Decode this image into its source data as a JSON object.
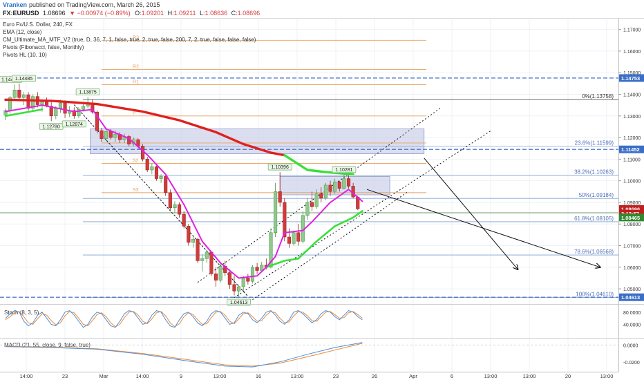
{
  "header": {
    "author": "Vranken",
    "published": "published on TradingView.com, March 26, 2015",
    "symbol": "FX:EURUSD",
    "last": "1.08696",
    "change": "▼ −0.00974 (−0.89%)",
    "ohlc": [
      {
        "k": "O:",
        "v": "1.09201"
      },
      {
        "k": "H:",
        "v": "1.09211"
      },
      {
        "k": "L:",
        "v": "1.08636"
      },
      {
        "k": "C:",
        "v": "1.08696"
      }
    ]
  },
  "studies": [
    "Euro Fx/U.S. Dollar, 240, FX",
    "EMA (12, close)",
    "CM_Ultimate_MA_MTF_V2 (true, D, 36, 7, 1, false, true, 2, true, false, 200, 7, 2, true, false, false, false)",
    "Pivots (Fibonacci, false, Monthly)",
    "Pivots HL (10, 10)"
  ],
  "colors": {
    "up_candle": "#8fc98c",
    "down_candle": "#d33b3b",
    "ma_red": "#e02020",
    "ma_green": "#39e039",
    "ema_magenta": "#e020e0",
    "pivot": "#e8a060",
    "fib": "#7f9fd0",
    "fib_text": "#4f6fb8",
    "dash_blue": "#3060c0",
    "price_tag": "#c02020",
    "green_tag": "#2f8a2f",
    "blue_tag": "#3a6fc8",
    "stoch_k": "#4f8fd8",
    "stoch_d": "#e88a3a",
    "zone": "#c8cde6"
  },
  "chart_data": {
    "type": "candlestick",
    "y_axis": {
      "ylim": [
        1.043,
        1.175
      ],
      "ticks": [
        "1.17000",
        "1.16000",
        "1.15000",
        "1.14000",
        "1.13000",
        "1.12000",
        "1.11000",
        "1.10000",
        "1.09000",
        "1.08000",
        "1.07000",
        "1.06000",
        "1.05000"
      ]
    },
    "x_axis": {
      "labels": [
        "14:00",
        "23",
        "Mar",
        "14:00",
        "9",
        "13:00",
        "16",
        "13:00",
        "23",
        "26",
        "Apr",
        "6",
        "13:00",
        "13:00",
        "20",
        "13:00"
      ]
    },
    "candles": [
      [
        1.1305,
        1.1335,
        1.128,
        1.1325
      ],
      [
        1.1325,
        1.1392,
        1.131,
        1.1385
      ],
      [
        1.1385,
        1.1445,
        1.1375,
        1.142
      ],
      [
        1.142,
        1.145,
        1.1375,
        1.1385
      ],
      [
        1.1385,
        1.141,
        1.135,
        1.1398
      ],
      [
        1.1398,
        1.141,
        1.1325,
        1.1335
      ],
      [
        1.1335,
        1.14,
        1.132,
        1.139
      ],
      [
        1.139,
        1.141,
        1.134,
        1.1352
      ],
      [
        1.1352,
        1.1375,
        1.132,
        1.1365
      ],
      [
        1.1365,
        1.1385,
        1.134,
        1.1345
      ],
      [
        1.1345,
        1.137,
        1.1276,
        1.13
      ],
      [
        1.13,
        1.1345,
        1.1285,
        1.1335
      ],
      [
        1.1335,
        1.1375,
        1.1315,
        1.136
      ],
      [
        1.136,
        1.1372,
        1.129,
        1.1312
      ],
      [
        1.1312,
        1.1345,
        1.1295,
        1.1325
      ],
      [
        1.1325,
        1.134,
        1.1287,
        1.13
      ],
      [
        1.13,
        1.134,
        1.129,
        1.133
      ],
      [
        1.133,
        1.136,
        1.132,
        1.1345
      ],
      [
        1.1345,
        1.1387,
        1.1335,
        1.136
      ],
      [
        1.136,
        1.1375,
        1.131,
        1.1318
      ],
      [
        1.1318,
        1.1325,
        1.122,
        1.1232
      ],
      [
        1.1232,
        1.1245,
        1.118,
        1.1195
      ],
      [
        1.1195,
        1.124,
        1.1185,
        1.1228
      ],
      [
        1.1228,
        1.124,
        1.119,
        1.12
      ],
      [
        1.12,
        1.1232,
        1.118,
        1.1215
      ],
      [
        1.1215,
        1.1225,
        1.1175,
        1.119
      ],
      [
        1.119,
        1.1218,
        1.1175,
        1.1205
      ],
      [
        1.1205,
        1.1212,
        1.116,
        1.117
      ],
      [
        1.117,
        1.12,
        1.116,
        1.119
      ],
      [
        1.119,
        1.1195,
        1.115,
        1.116
      ],
      [
        1.116,
        1.117,
        1.109,
        1.11
      ],
      [
        1.11,
        1.111,
        1.104,
        1.105
      ],
      [
        1.105,
        1.108,
        1.103,
        1.1065
      ],
      [
        1.1065,
        1.107,
        1.1,
        1.101
      ],
      [
        1.101,
        1.103,
        1.099,
        1.102
      ],
      [
        1.102,
        1.1025,
        1.093,
        1.0945
      ],
      [
        1.0945,
        1.096,
        1.086,
        1.0875
      ],
      [
        1.0875,
        1.0905,
        1.085,
        1.089
      ],
      [
        1.089,
        1.09,
        1.083,
        1.0845
      ],
      [
        1.0845,
        1.086,
        1.078,
        1.079
      ],
      [
        1.079,
        1.08,
        1.07,
        1.0715
      ],
      [
        1.0715,
        1.074,
        1.069,
        1.073
      ],
      [
        1.073,
        1.0735,
        1.062,
        1.063
      ],
      [
        1.063,
        1.066,
        1.058,
        1.064
      ],
      [
        1.064,
        1.068,
        1.062,
        1.067
      ],
      [
        1.067,
        1.0675,
        1.056,
        1.057
      ],
      [
        1.057,
        1.06,
        1.051,
        1.054
      ],
      [
        1.054,
        1.062,
        1.053,
        1.0605
      ],
      [
        1.0605,
        1.063,
        1.056,
        1.0575
      ],
      [
        1.0575,
        1.059,
        1.05,
        1.052
      ],
      [
        1.052,
        1.056,
        1.047,
        1.049
      ],
      [
        1.049,
        1.052,
        1.0462,
        1.051
      ],
      [
        1.051,
        1.056,
        1.049,
        1.055
      ],
      [
        1.055,
        1.057,
        1.052,
        1.0535
      ],
      [
        1.0535,
        1.061,
        1.0525,
        1.06
      ],
      [
        1.06,
        1.062,
        1.057,
        1.0585
      ],
      [
        1.0585,
        1.0625,
        1.058,
        1.061
      ],
      [
        1.061,
        1.064,
        1.059,
        1.06
      ],
      [
        1.06,
        1.078,
        1.0595,
        1.076
      ],
      [
        1.076,
        1.099,
        1.074,
        1.095
      ],
      [
        1.095,
        1.104,
        1.088,
        1.09
      ],
      [
        1.09,
        1.092,
        1.072,
        1.074
      ],
      [
        1.074,
        1.078,
        1.069,
        1.071
      ],
      [
        1.071,
        1.077,
        1.07,
        1.076
      ],
      [
        1.076,
        1.08,
        1.07,
        1.072
      ],
      [
        1.072,
        1.086,
        1.071,
        1.084
      ],
      [
        1.084,
        1.092,
        1.082,
        1.09
      ],
      [
        1.09,
        1.095,
        1.086,
        1.088
      ],
      [
        1.088,
        1.096,
        1.087,
        1.094
      ],
      [
        1.094,
        1.097,
        1.09,
        1.092
      ],
      [
        1.092,
        1.099,
        1.091,
        1.098
      ],
      [
        1.098,
        1.1,
        1.093,
        1.095
      ],
      [
        1.095,
        1.101,
        1.094,
        1.0995
      ],
      [
        1.0995,
        1.1,
        1.095,
        1.0965
      ],
      [
        1.0965,
        1.1028,
        1.096,
        1.101
      ],
      [
        1.101,
        1.1025,
        1.0965,
        1.0975
      ],
      [
        1.0975,
        1.099,
        1.092,
        1.0925
      ],
      [
        1.0925,
        1.093,
        1.0864,
        1.087
      ]
    ],
    "red_ma": [
      [
        0,
        1.1375
      ],
      [
        10,
        1.137
      ],
      [
        20,
        1.1355
      ],
      [
        30,
        1.132
      ],
      [
        38,
        1.128
      ],
      [
        46,
        1.1225
      ],
      [
        52,
        1.117
      ],
      [
        58,
        1.113
      ],
      [
        61,
        1.1118
      ]
    ],
    "green_ma": [
      [
        61,
        1.1118
      ],
      [
        66,
        1.105
      ],
      [
        70,
        1.104
      ],
      [
        76,
        1.103
      ]
    ],
    "ema12": [
      [
        0,
        1.132
      ],
      [
        8,
        1.135
      ],
      [
        15,
        1.132
      ],
      [
        19,
        1.133
      ],
      [
        22,
        1.124
      ],
      [
        27,
        1.1195
      ],
      [
        31,
        1.112
      ],
      [
        35,
        1.103
      ],
      [
        39,
        1.089
      ],
      [
        43,
        1.072
      ],
      [
        47,
        1.062
      ],
      [
        51,
        1.055
      ],
      [
        55,
        1.056
      ],
      [
        57,
        1.06
      ],
      [
        59,
        1.065
      ],
      [
        61,
        1.076
      ],
      [
        65,
        1.077
      ],
      [
        67,
        1.081
      ],
      [
        71,
        1.09
      ],
      [
        75,
        1.096
      ],
      [
        78,
        1.0905
      ]
    ],
    "ema_slow_green": [
      [
        0,
        1.13
      ],
      [
        8,
        1.133
      ]
    ],
    "ema_slow_green2": [
      [
        57,
        1.06
      ],
      [
        61,
        1.063
      ],
      [
        64,
        1.064
      ],
      [
        68,
        1.072
      ],
      [
        72,
        1.079
      ],
      [
        76,
        1.083
      ],
      [
        78,
        1.086
      ]
    ],
    "pivots": [
      {
        "label": "R3",
        "value": 1.165,
        "from": 21,
        "to": 92
      },
      {
        "label": "R2",
        "value": 1.1515,
        "from": 21,
        "to": 92
      },
      {
        "label": "R1",
        "value": 1.1445,
        "from": 21,
        "to": 92
      },
      {
        "label": "P",
        "value": 1.13,
        "from": 21,
        "to": 92
      },
      {
        "label": "S1",
        "value": 1.1175,
        "from": 21,
        "to": 92
      },
      {
        "label": "S2",
        "value": 1.108,
        "from": 21,
        "to": 92
      },
      {
        "label": "S3",
        "value": 1.0945,
        "from": 21,
        "to": 92
      }
    ],
    "fib_levels": [
      {
        "label": "0%(1.13758)",
        "value": 1.13758
      },
      {
        "label": "23.6%(1.11599)",
        "value": 1.11599
      },
      {
        "label": "38.2%(1.10263)",
        "value": 1.10263
      },
      {
        "label": "50%(1.09184)",
        "value": 1.09184
      },
      {
        "label": "61.8%(1.08105)",
        "value": 1.08105
      },
      {
        "label": "78.6%(1.06568)",
        "value": 1.06568
      },
      {
        "label": "100%(1.04610)",
        "value": 1.0461
      }
    ],
    "hl_labels": [
      {
        "text": "1.14472",
        "i": 1,
        "v": 1.1445,
        "pos": "above"
      },
      {
        "text": "1.14485",
        "i": 4,
        "v": 1.145,
        "pos": "above"
      },
      {
        "text": "1.13875",
        "i": 18,
        "v": 1.1387,
        "pos": "above"
      },
      {
        "text": "1.12780",
        "i": 10,
        "v": 1.1276,
        "pos": "below"
      },
      {
        "text": "1.12874",
        "i": 15,
        "v": 1.1287,
        "pos": "below"
      },
      {
        "text": "1.04613",
        "i": 51,
        "v": 1.0462,
        "pos": "below"
      },
      {
        "text": "1.10396",
        "i": 60,
        "v": 1.104,
        "pos": "above"
      },
      {
        "text": "1.10281",
        "i": 74,
        "v": 1.1028,
        "pos": "above"
      }
    ],
    "zones": [
      {
        "i0": 18.5,
        "i1": 91.5,
        "v0": 1.124,
        "v1": 1.1125
      },
      {
        "i0": 60,
        "i1": 84,
        "v0": 1.102,
        "v1": 1.0935
      }
    ],
    "price_tags": [
      {
        "text": "1.14753",
        "value": 1.14753,
        "kind": "blue"
      },
      {
        "text": "1.11452",
        "value": 1.11452,
        "kind": "blue"
      },
      {
        "text": "1.08696",
        "value": 1.08696,
        "kind": "red"
      },
      {
        "text": "3:13:57",
        "value": 1.0848,
        "kind": "red"
      },
      {
        "text": "1.08465",
        "value": 1.083,
        "kind": "green"
      },
      {
        "text": "1.04613",
        "value": 1.04613,
        "kind": "blue"
      }
    ],
    "stoch": {
      "title": "Stoch (8, 3, 5)",
      "ticks": [
        "80.0000",
        "40.0000"
      ],
      "k": [
        60,
        75,
        85,
        80,
        50,
        35,
        45,
        70,
        80,
        60,
        40,
        35,
        55,
        80,
        85,
        70,
        50,
        30,
        40,
        65,
        80,
        75,
        55,
        35,
        30,
        50,
        75,
        85,
        80,
        60,
        40,
        45,
        70,
        85,
        80,
        55,
        35,
        30,
        55,
        75,
        80,
        65,
        45,
        35,
        50,
        75,
        85,
        80,
        60,
        40,
        45,
        70,
        80,
        75,
        55,
        45,
        60,
        80,
        85,
        70,
        50,
        40,
        55,
        80,
        85,
        75,
        60,
        45,
        55,
        75,
        85,
        80,
        65,
        55,
        70,
        85,
        80,
        65,
        55
      ],
      "d": [
        55,
        65,
        78,
        82,
        65,
        45,
        40,
        58,
        75,
        70,
        52,
        38,
        45,
        68,
        82,
        78,
        60,
        40,
        35,
        52,
        72,
        78,
        65,
        45,
        32,
        40,
        62,
        80,
        82,
        70,
        50,
        42,
        58,
        78,
        82,
        68,
        45,
        32,
        42,
        65,
        78,
        72,
        55,
        40,
        42,
        62,
        80,
        82,
        70,
        50,
        42,
        58,
        75,
        78,
        65,
        50,
        52,
        70,
        82,
        78,
        60,
        45,
        48,
        68,
        82,
        80,
        68,
        52,
        50,
        65,
        80,
        82,
        72,
        60,
        62,
        78,
        82,
        72,
        60
      ]
    },
    "macd": {
      "title": "MACD (21, 55, close, 9, false, true)",
      "ticks": [
        "0.0000",
        "-0.0200"
      ],
      "line": [
        [
          0,
          -0.002
        ],
        [
          10,
          -0.003
        ],
        [
          20,
          -0.005
        ],
        [
          30,
          -0.011
        ],
        [
          40,
          -0.019
        ],
        [
          48,
          -0.025
        ],
        [
          54,
          -0.026
        ],
        [
          60,
          -0.02
        ],
        [
          66,
          -0.011
        ],
        [
          72,
          -0.003
        ],
        [
          78,
          0.003
        ]
      ],
      "signal": [
        [
          0,
          -0.0015
        ],
        [
          10,
          -0.0025
        ],
        [
          20,
          -0.0045
        ],
        [
          30,
          -0.01
        ],
        [
          40,
          -0.0175
        ],
        [
          48,
          -0.0235
        ],
        [
          54,
          -0.025
        ],
        [
          60,
          -0.0215
        ],
        [
          66,
          -0.014
        ],
        [
          72,
          -0.006
        ],
        [
          78,
          0.002
        ]
      ]
    }
  }
}
